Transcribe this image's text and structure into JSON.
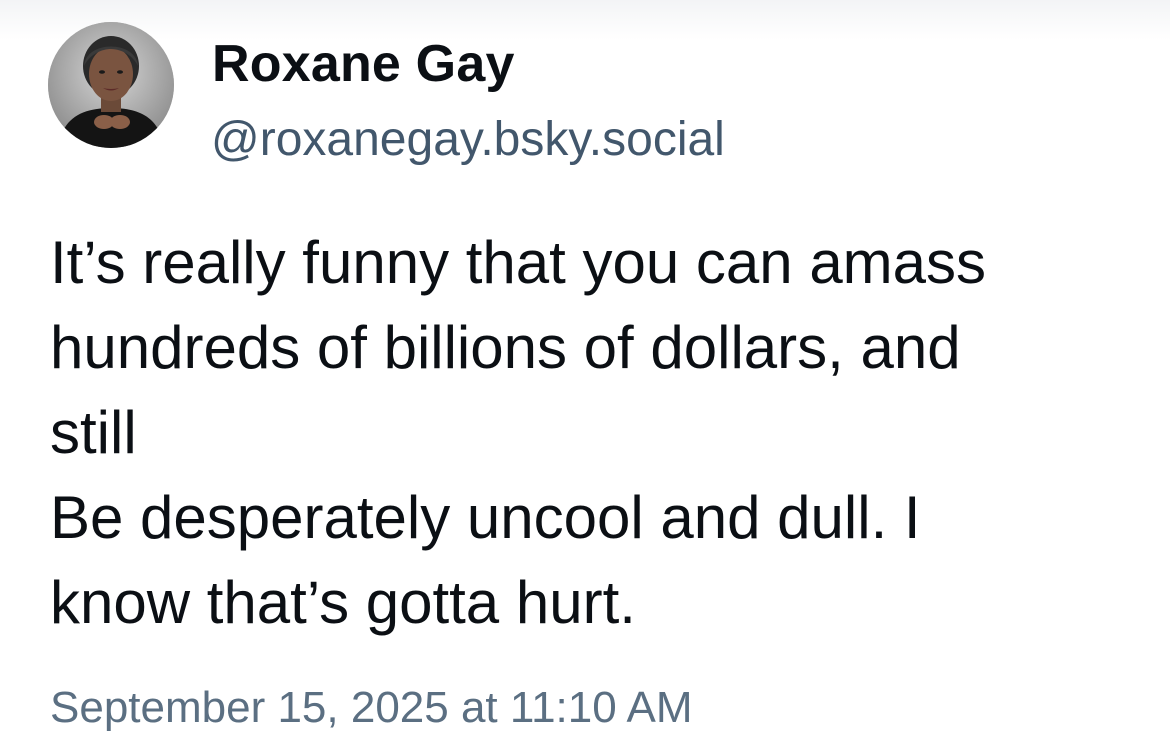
{
  "author": {
    "display_name": "Roxane Gay",
    "handle": "@roxanegay.bsky.social",
    "avatar_icon": "profile-photo"
  },
  "post": {
    "text_lines": [
      "It’s really funny that you can amass",
      "hundreds of billions of dollars, and",
      "still",
      "Be desperately uncool and dull. I",
      "know that’s gotta hurt."
    ],
    "timestamp": "September 15, 2025 at 11:10 AM"
  },
  "colors": {
    "text": "#0b0f14",
    "handle": "#42576c",
    "timestamp": "#5b6f82",
    "background": "#ffffff"
  }
}
